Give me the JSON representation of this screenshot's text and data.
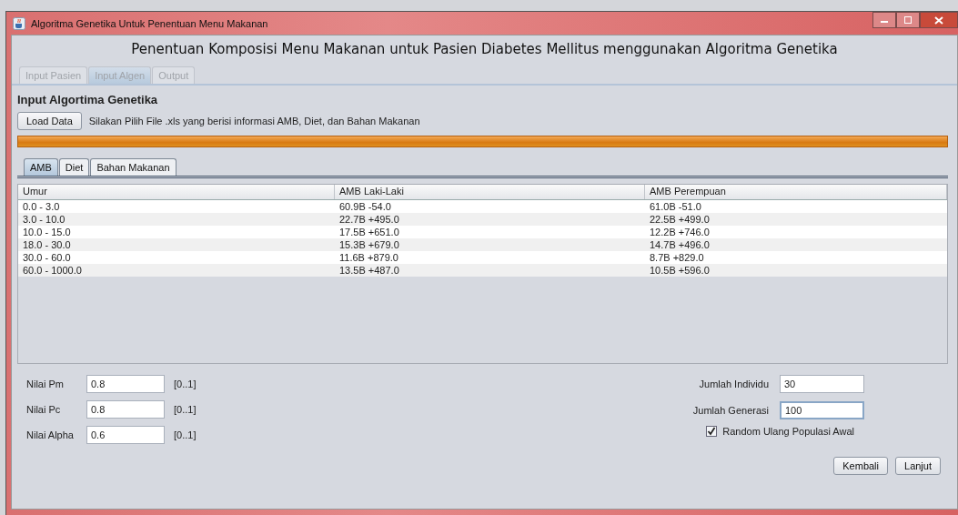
{
  "window": {
    "title": "Algoritma Genetika Untuk Penentuan Menu Makanan"
  },
  "heading": "Penentuan Komposisi Menu Makanan untuk Pasien Diabetes Mellitus menggunakan Algoritma Genetika",
  "tabs": [
    {
      "label": "Input Pasien",
      "selected": false,
      "disabled": true
    },
    {
      "label": "Input Algen",
      "selected": true,
      "disabled": true
    },
    {
      "label": "Output",
      "selected": false,
      "disabled": true
    }
  ],
  "section_title": "Input Algortima Genetika",
  "load_button": "Load Data",
  "load_hint": "Silakan Pilih File .xls yang berisi informasi AMB, Diet, dan Bahan Makanan",
  "progress": {
    "level": 1
  },
  "data_tabs": [
    {
      "label": "AMB",
      "selected": true
    },
    {
      "label": "Diet",
      "selected": false
    },
    {
      "label": "Bahan Makanan",
      "selected": false
    }
  ],
  "table": {
    "columns": [
      "Umur",
      "AMB Laki-Laki",
      "AMB Perempuan"
    ],
    "rows": [
      [
        "0.0 - 3.0",
        "60.9B -54.0",
        "61.0B -51.0"
      ],
      [
        "3.0 - 10.0",
        "22.7B +495.0",
        "22.5B +499.0"
      ],
      [
        "10.0 - 15.0",
        "17.5B +651.0",
        "12.2B +746.0"
      ],
      [
        "18.0 - 30.0",
        "15.3B +679.0",
        "14.7B +496.0"
      ],
      [
        "30.0 - 60.0",
        "11.6B +879.0",
        "8.7B +829.0"
      ],
      [
        "60.0 - 1000.0",
        "13.5B +487.0",
        "10.5B +596.0"
      ]
    ]
  },
  "left_fields": [
    {
      "label": "Nilai Pm",
      "value": "0.8",
      "range": "[0..1]"
    },
    {
      "label": "Nilai Pc",
      "value": "0.8",
      "range": "[0..1]"
    },
    {
      "label": "Nilai Alpha",
      "value": "0.6",
      "range": "[0..1]"
    }
  ],
  "right_fields": [
    {
      "label": "Jumlah Individu",
      "value": "30",
      "focused": false
    },
    {
      "label": "Jumlah Generasi",
      "value": "100",
      "focused": true
    }
  ],
  "checkbox": {
    "label": "Random Ulang Populasi Awal",
    "checked": true
  },
  "buttons": [
    "Kembali",
    "Lanjut"
  ]
}
